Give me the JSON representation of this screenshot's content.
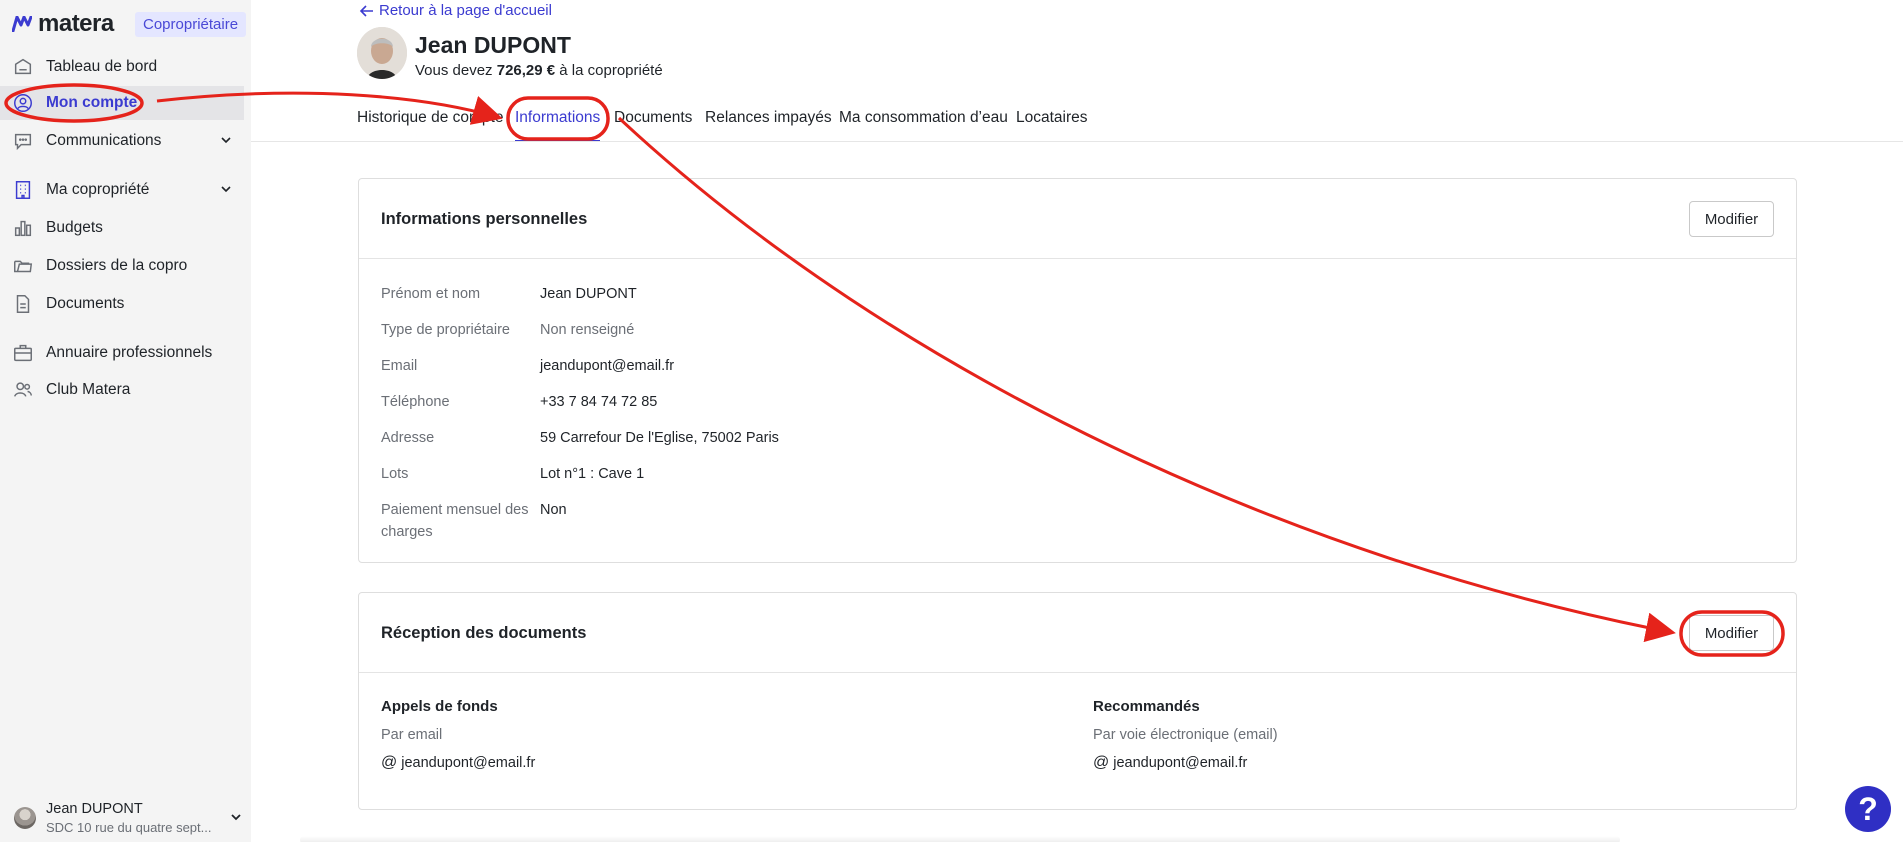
{
  "brand": {
    "name": "matera",
    "badge": "Copropriétaire"
  },
  "sidebar": {
    "items": [
      {
        "label": "Tableau de bord"
      },
      {
        "label": "Mon compte"
      },
      {
        "label": "Communications"
      },
      {
        "label": "Ma copropriété"
      },
      {
        "label": "Budgets"
      },
      {
        "label": "Dossiers de la copro"
      },
      {
        "label": "Documents"
      },
      {
        "label": "Annuaire professionnels"
      },
      {
        "label": "Club Matera"
      }
    ],
    "user": {
      "name": "Jean DUPONT",
      "subtitle": "SDC 10 rue du quatre sept..."
    }
  },
  "header": {
    "back_label": "Retour à la page d'accueil",
    "owner_name": "Jean DUPONT",
    "debt_prefix": "Vous devez",
    "debt_amount": "726,29 €",
    "debt_suffix": "à la copropriété"
  },
  "tabs": [
    {
      "label": "Historique de compte"
    },
    {
      "label": "Informations"
    },
    {
      "label": "Documents"
    },
    {
      "label": "Relances impayés"
    },
    {
      "label": "Ma consommation d’eau"
    },
    {
      "label": "Locataires"
    }
  ],
  "personal_info": {
    "title": "Informations personnelles",
    "edit_label": "Modifier",
    "rows": [
      {
        "label": "Prénom et nom",
        "value": "Jean DUPONT"
      },
      {
        "label": "Type de propriétaire",
        "value": "Non renseigné"
      },
      {
        "label": "Email",
        "value": "jeandupont@email.fr"
      },
      {
        "label": "Téléphone",
        "value": "+33 7 84 74 72 85"
      },
      {
        "label": "Adresse",
        "value": "59 Carrefour De l'Eglise, 75002 Paris"
      },
      {
        "label": "Lots",
        "value": "Lot n°1 : Cave 1"
      },
      {
        "label": "Paiement mensuel des charges",
        "value": "Non"
      }
    ]
  },
  "documents_reception": {
    "title": "Réception des documents",
    "edit_label": "Modifier",
    "columns": [
      {
        "title": "Appels de fonds",
        "mode": "Par email",
        "email": "jeandupont@email.fr"
      },
      {
        "title": "Recommandés",
        "mode": "Par voie électronique (email)",
        "email": "jeandupont@email.fr"
      }
    ]
  },
  "help": {
    "label": "?"
  },
  "colors": {
    "accent": "#3b3bd0",
    "annotation": "#e5231b",
    "sidebar_bg": "#f4f4f4"
  }
}
